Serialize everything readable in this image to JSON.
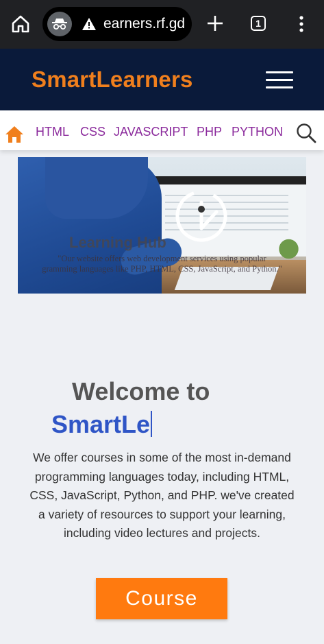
{
  "browser": {
    "url": "earners.rf.gd",
    "tab_count": "1",
    "icons": [
      "home-icon",
      "incognito-icon",
      "warning-icon",
      "new-tab-icon",
      "tab-switcher-icon",
      "more-menu-icon"
    ]
  },
  "header": {
    "brand": "SmartLearners",
    "brand_color": "#f07f1d",
    "background_color": "#0a1a3a"
  },
  "nav": {
    "items": [
      {
        "label": "HTML"
      },
      {
        "label": "CSS"
      },
      {
        "label": "JAVASCRIPT"
      },
      {
        "label": "PHP"
      },
      {
        "label": "PYTHON"
      }
    ],
    "link_color": "#8b2a9c",
    "home_icon_color": "#f07f1d"
  },
  "hero": {
    "title": "Learning Hub",
    "quote_line1": "\"Our website offers web development services using popular",
    "quote_line2": "gramming languages like PHP, HTML, CSS, JavaScript, and Python.\""
  },
  "welcome": {
    "heading": "Welcome to",
    "typed_text": "SmartLe",
    "typed_color": "#2f55c6",
    "description": "We offer courses in some of the most in-demand programming languages today, including HTML, CSS, JavaScript, Python, and PHP. we've created a variety of resources to support your learning, including video lectures and projects."
  },
  "cta": {
    "label": "Course",
    "color": "#ff7a0f"
  }
}
